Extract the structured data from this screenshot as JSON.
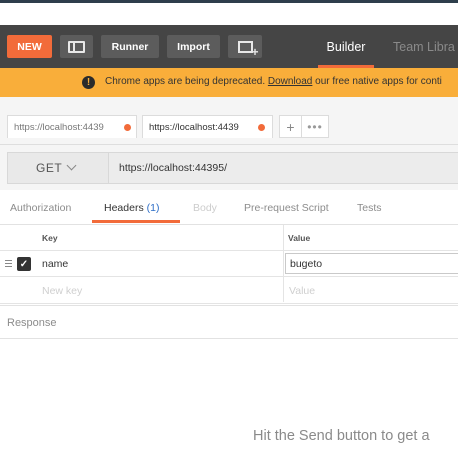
{
  "toolbar": {
    "new_label": "NEW",
    "runner_label": "Runner",
    "import_label": "Import",
    "builder_label": "Builder",
    "team_library_label": "Team Libra",
    "accent_color": "#f26b3a"
  },
  "banner": {
    "text_before": "Chrome apps are being deprecated.",
    "link_text": "Download",
    "text_after": "our free native apps for conti",
    "background": "#f9ae3a"
  },
  "request_tabs": [
    {
      "label": "https://localhost:4439",
      "unsaved": true
    },
    {
      "label": "https://localhost:4439",
      "unsaved": true
    }
  ],
  "tab_actions": {
    "add": "+",
    "more": "•••"
  },
  "request": {
    "method": "GET",
    "url": "https://localhost:44395/"
  },
  "subtabs": {
    "authorization": "Authorization",
    "headers": "Headers",
    "headers_count": "(1)",
    "body": "Body",
    "prerequest": "Pre-request Script",
    "tests": "Tests"
  },
  "headers_table": {
    "key_column": "Key",
    "value_column": "Value",
    "rows": [
      {
        "key": "name",
        "value": "bugeto",
        "checked": true
      }
    ],
    "new_key_placeholder": "New key",
    "new_value_placeholder": "Value"
  },
  "response": {
    "label": "Response",
    "hint": "Hit the Send button to get a"
  }
}
